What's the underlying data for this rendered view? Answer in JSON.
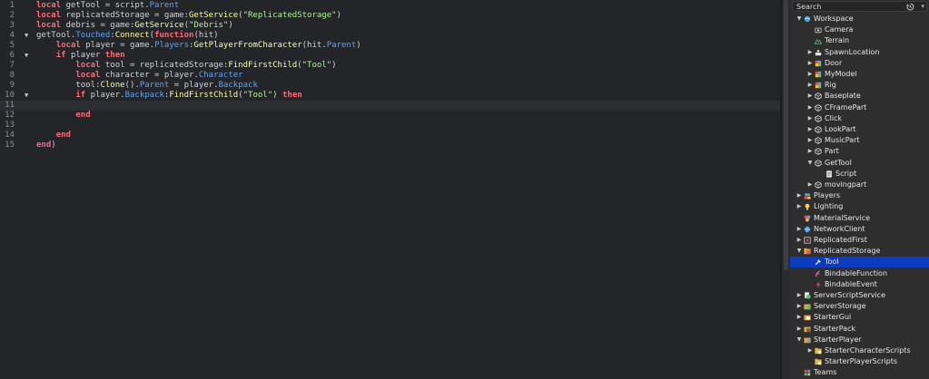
{
  "editor": {
    "lines": [
      {
        "n": "1",
        "tokens": [
          {
            "t": "local",
            "c": "kw"
          },
          {
            "t": " getTool = ",
            "c": "id"
          },
          {
            "t": "script",
            "c": "id"
          },
          {
            "t": ".",
            "c": "op"
          },
          {
            "t": "Parent",
            "c": "prop"
          }
        ]
      },
      {
        "n": "2",
        "tokens": [
          {
            "t": "local",
            "c": "kw"
          },
          {
            "t": " replicatedStorage = game:",
            "c": "id"
          },
          {
            "t": "GetService",
            "c": "fn"
          },
          {
            "t": "(",
            "c": "op"
          },
          {
            "t": "\"ReplicatedStorage\"",
            "c": "str"
          },
          {
            "t": ")",
            "c": "op"
          }
        ]
      },
      {
        "n": "3",
        "tokens": [
          {
            "t": "local",
            "c": "kw"
          },
          {
            "t": " debris = game:",
            "c": "id"
          },
          {
            "t": "GetService",
            "c": "fn"
          },
          {
            "t": "(",
            "c": "op"
          },
          {
            "t": "\"Debris\"",
            "c": "str"
          },
          {
            "t": ")",
            "c": "op"
          }
        ]
      },
      {
        "n": "4",
        "fold": true,
        "tokens": [
          {
            "t": "getTool.",
            "c": "id"
          },
          {
            "t": "Touched",
            "c": "prop"
          },
          {
            "t": ":",
            "c": "op"
          },
          {
            "t": "Connect",
            "c": "fn"
          },
          {
            "t": "(",
            "c": "op"
          },
          {
            "t": "function",
            "c": "kw"
          },
          {
            "t": "(hit)",
            "c": "id"
          }
        ]
      },
      {
        "n": "5",
        "tokens": [
          {
            "t": "    ",
            "c": "id"
          },
          {
            "t": "local",
            "c": "kw"
          },
          {
            "t": " player = game.",
            "c": "id"
          },
          {
            "t": "Players",
            "c": "prop"
          },
          {
            "t": ":",
            "c": "op"
          },
          {
            "t": "GetPlayerFromCharacter",
            "c": "fn"
          },
          {
            "t": "(hit.",
            "c": "id"
          },
          {
            "t": "Parent",
            "c": "prop"
          },
          {
            "t": ")",
            "c": "op"
          }
        ]
      },
      {
        "n": "6",
        "fold": true,
        "tokens": [
          {
            "t": "    ",
            "c": "id"
          },
          {
            "t": "if",
            "c": "kw"
          },
          {
            "t": " player ",
            "c": "id"
          },
          {
            "t": "then",
            "c": "kw"
          }
        ]
      },
      {
        "n": "7",
        "tokens": [
          {
            "t": "        ",
            "c": "id"
          },
          {
            "t": "local",
            "c": "kw"
          },
          {
            "t": " tool = replicatedStorage:",
            "c": "id"
          },
          {
            "t": "FindFirstChild",
            "c": "fn"
          },
          {
            "t": "(",
            "c": "op"
          },
          {
            "t": "\"Tool\"",
            "c": "str"
          },
          {
            "t": ")",
            "c": "op"
          }
        ]
      },
      {
        "n": "8",
        "tokens": [
          {
            "t": "        ",
            "c": "id"
          },
          {
            "t": "local",
            "c": "kw"
          },
          {
            "t": " character = player.",
            "c": "id"
          },
          {
            "t": "Character",
            "c": "prop"
          }
        ]
      },
      {
        "n": "9",
        "tokens": [
          {
            "t": "        tool:",
            "c": "id"
          },
          {
            "t": "Clone",
            "c": "fn"
          },
          {
            "t": "().",
            "c": "op"
          },
          {
            "t": "Parent",
            "c": "prop"
          },
          {
            "t": " = player.",
            "c": "id"
          },
          {
            "t": "Backpack",
            "c": "prop"
          }
        ]
      },
      {
        "n": "10",
        "fold": true,
        "tokens": [
          {
            "t": "        ",
            "c": "id"
          },
          {
            "t": "if",
            "c": "kw"
          },
          {
            "t": " player.",
            "c": "id"
          },
          {
            "t": "Backpack",
            "c": "prop"
          },
          {
            "t": ":",
            "c": "op"
          },
          {
            "t": "FindFirstChild",
            "c": "fn"
          },
          {
            "t": "(",
            "c": "op"
          },
          {
            "t": "\"Tool\"",
            "c": "str"
          },
          {
            "t": ") ",
            "c": "op"
          },
          {
            "t": "then",
            "c": "kw"
          }
        ]
      },
      {
        "n": "11",
        "current": true,
        "tokens": []
      },
      {
        "n": "12",
        "tokens": [
          {
            "t": "        ",
            "c": "id"
          },
          {
            "t": "end",
            "c": "kw"
          }
        ]
      },
      {
        "n": "13",
        "tokens": []
      },
      {
        "n": "14",
        "tokens": [
          {
            "t": "    ",
            "c": "id"
          },
          {
            "t": "end",
            "c": "kw"
          }
        ]
      },
      {
        "n": "15",
        "tokens": [
          {
            "t": "end",
            "c": "kw"
          },
          {
            "t": ")",
            "c": "op"
          }
        ]
      }
    ]
  },
  "explorer": {
    "search_placeholder": "Search",
    "items": [
      {
        "label": "Workspace",
        "depth": 0,
        "arrow": "down",
        "icon": "workspace-icon"
      },
      {
        "label": "Camera",
        "depth": 1,
        "arrow": "",
        "icon": "camera-icon"
      },
      {
        "label": "Terrain",
        "depth": 1,
        "arrow": "",
        "icon": "terrain-icon"
      },
      {
        "label": "SpawnLocation",
        "depth": 1,
        "arrow": "right",
        "icon": "spawn-location-icon"
      },
      {
        "label": "Door",
        "depth": 1,
        "arrow": "right",
        "icon": "model-icon"
      },
      {
        "label": "MyModel",
        "depth": 1,
        "arrow": "right",
        "icon": "model-icon"
      },
      {
        "label": "Rig",
        "depth": 1,
        "arrow": "right",
        "icon": "model-icon"
      },
      {
        "label": "Baseplate",
        "depth": 1,
        "arrow": "right",
        "icon": "part-icon"
      },
      {
        "label": "CFramePart",
        "depth": 1,
        "arrow": "right",
        "icon": "part-icon"
      },
      {
        "label": "Click",
        "depth": 1,
        "arrow": "right",
        "icon": "part-icon"
      },
      {
        "label": "LookPart",
        "depth": 1,
        "arrow": "right",
        "icon": "part-icon"
      },
      {
        "label": "MusicPart",
        "depth": 1,
        "arrow": "right",
        "icon": "part-icon"
      },
      {
        "label": "Part",
        "depth": 1,
        "arrow": "right",
        "icon": "part-icon"
      },
      {
        "label": "GetTool",
        "depth": 1,
        "arrow": "down",
        "icon": "part-icon"
      },
      {
        "label": "Script",
        "depth": 2,
        "arrow": "",
        "icon": "script-icon"
      },
      {
        "label": "movingpart",
        "depth": 1,
        "arrow": "right",
        "icon": "part-icon"
      },
      {
        "label": "Players",
        "depth": 0,
        "arrow": "right",
        "icon": "players-icon"
      },
      {
        "label": "Lighting",
        "depth": 0,
        "arrow": "right",
        "icon": "lighting-icon"
      },
      {
        "label": "MaterialService",
        "depth": 0,
        "arrow": "",
        "icon": "material-service-icon"
      },
      {
        "label": "NetworkClient",
        "depth": 0,
        "arrow": "right",
        "icon": "network-client-icon"
      },
      {
        "label": "ReplicatedFirst",
        "depth": 0,
        "arrow": "right",
        "icon": "replicated-first-icon"
      },
      {
        "label": "ReplicatedStorage",
        "depth": 0,
        "arrow": "down",
        "icon": "replicated-storage-icon"
      },
      {
        "label": "Tool",
        "depth": 1,
        "arrow": "",
        "icon": "tool-icon",
        "selected": true
      },
      {
        "label": "BindableFunction",
        "depth": 1,
        "arrow": "",
        "icon": "bindable-function-icon"
      },
      {
        "label": "BindableEvent",
        "depth": 1,
        "arrow": "",
        "icon": "bindable-event-icon"
      },
      {
        "label": "ServerScriptService",
        "depth": 0,
        "arrow": "right",
        "icon": "server-script-service-icon"
      },
      {
        "label": "ServerStorage",
        "depth": 0,
        "arrow": "right",
        "icon": "server-storage-icon"
      },
      {
        "label": "StarterGui",
        "depth": 0,
        "arrow": "right",
        "icon": "starter-gui-icon"
      },
      {
        "label": "StarterPack",
        "depth": 0,
        "arrow": "right",
        "icon": "starter-pack-icon"
      },
      {
        "label": "StarterPlayer",
        "depth": 0,
        "arrow": "down",
        "icon": "starter-player-icon"
      },
      {
        "label": "StarterCharacterScripts",
        "depth": 1,
        "arrow": "right",
        "icon": "folder-icon"
      },
      {
        "label": "StarterPlayerScripts",
        "depth": 1,
        "arrow": "",
        "icon": "folder-icon"
      },
      {
        "label": "Teams",
        "depth": 0,
        "arrow": "",
        "icon": "teams-icon"
      }
    ]
  },
  "colors": {
    "editor_bg": "#232529",
    "keyword": "#f86d7c",
    "string": "#adf195",
    "method": "#fdfbac",
    "property": "#61a1f1",
    "selection": "#0b3bbe"
  }
}
